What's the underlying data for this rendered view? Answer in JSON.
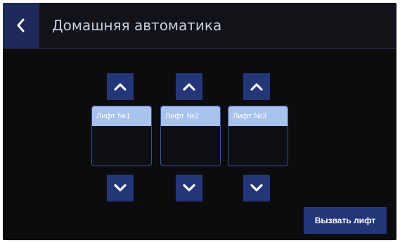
{
  "header": {
    "title": "Домашняя автоматика",
    "back_icon": "chevron-left-icon"
  },
  "lifts": [
    {
      "label": "Лифт №1",
      "up_icon": "chevron-up-icon",
      "down_icon": "chevron-down-icon"
    },
    {
      "label": "Лифт №2",
      "up_icon": "chevron-up-icon",
      "down_icon": "chevron-down-icon"
    },
    {
      "label": "Лифт №3",
      "up_icon": "chevron-up-icon",
      "down_icon": "chevron-down-icon"
    }
  ],
  "actions": {
    "call_label": "Вызвать лифт"
  },
  "colors": {
    "accent": "#24367a",
    "label_bg": "#a6c2ef",
    "background": "#0c0c0d"
  }
}
